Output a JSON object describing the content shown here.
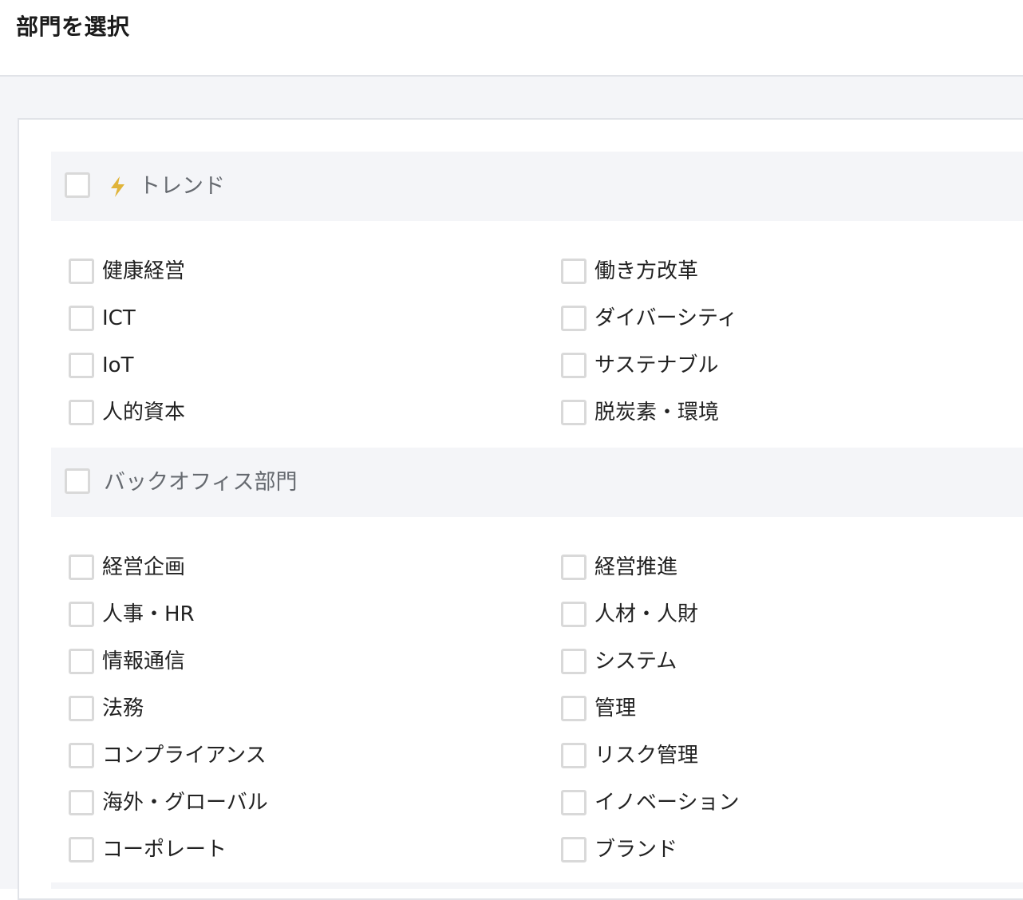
{
  "page": {
    "title": "部門を選択"
  },
  "colors": {
    "accent_bolt": "#e0b43a",
    "section_bg": "#f4f5f8",
    "checkbox_border": "#d9d9d9"
  },
  "sections": [
    {
      "label": "トレンド",
      "icon": "lightning-bolt-icon",
      "items_left": [
        "健康経営",
        "ICT",
        "IoT",
        "人的資本"
      ],
      "items_right": [
        "働き方改革",
        "ダイバーシティ",
        "サステナブル",
        "脱炭素・環境"
      ]
    },
    {
      "label": "バックオフィス部門",
      "items_left": [
        "経営企画",
        "人事・HR",
        "情報通信",
        "法務",
        "コンプライアンス",
        "海外・グローバル",
        "コーポレート"
      ],
      "items_right": [
        "経営推進",
        "人材・人財",
        "システム",
        "管理",
        "リスク管理",
        "イノベーション",
        "ブランド"
      ]
    }
  ]
}
